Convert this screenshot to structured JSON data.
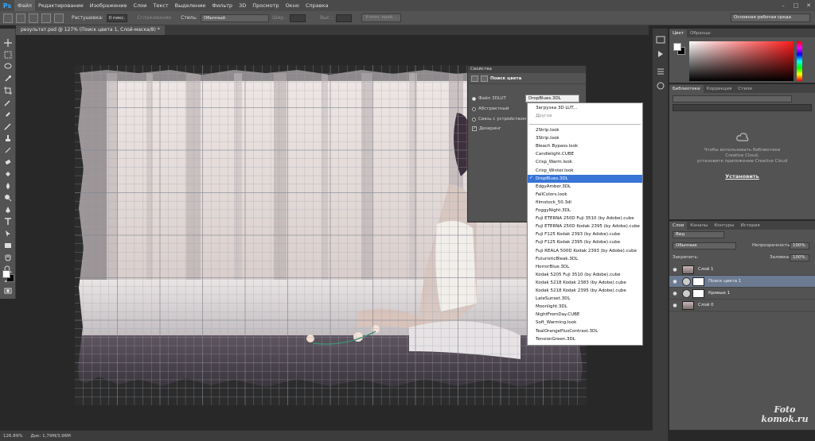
{
  "app": {
    "logo": "Ps",
    "menu": [
      "Файл",
      "Редактирование",
      "Изображение",
      "Слои",
      "Текст",
      "Выделение",
      "Фильтр",
      "3D",
      "Просмотр",
      "Окно",
      "Справка"
    ],
    "window_controls": [
      "–",
      "□",
      "✕"
    ]
  },
  "options": {
    "feather_label": "Растушевка:",
    "feather_value": "0 пикс.",
    "antialias_label": "Сглаживание",
    "style_label": "Стиль:",
    "style_value": "Обычный",
    "width_label": "Шир.:",
    "height_label": "Выс.:",
    "refine_label": "Уточн. край...",
    "workspace": "Основная рабочая среда"
  },
  "document": {
    "tab_label": "результат.psd @ 127% (Поиск цвета 1, Слой-маска/8) *"
  },
  "status": {
    "zoom": "126.89%",
    "doc_size": "Док: 1,79M/3,96M"
  },
  "properties": {
    "header": "Свойства",
    "title": "Поиск цвета",
    "options": [
      "Файл 3DLUT",
      "Абстрактный",
      "Связь с устройством",
      "Дизеринг"
    ],
    "lut_selected": "DropBlues.3DL"
  },
  "dropdown": {
    "top_items": [
      "Загрузка 3D LUT...",
      "Другое"
    ],
    "items": [
      "2Strip.look",
      "3Strip.look",
      "Bleach Bypass.look",
      "Candlelight.CUBE",
      "Crisp_Warm.look",
      "Crisp_Winter.look",
      "DropBlues.3DL",
      "EdgyAmber.3DL",
      "FallColors.look",
      "filmstock_50.3dl",
      "FoggyNight.3DL",
      "Fuji ETERNA 250D Fuji 3510 (by Adobe).cube",
      "Fuji ETERNA 250D Kodak 2395 (by Adobe).cube",
      "Fuji F125 Kodak 2393 (by Adobe).cube",
      "Fuji F125 Kodak 2395 (by Adobe).cube",
      "Fuji REALA 500D Kodak 2393 (by Adobe).cube",
      "FuturisticBleak.3DL",
      "HorrorBlue.3DL",
      "Kodak 5205 Fuji 3510 (by Adobe).cube",
      "Kodak 5218 Kodak 2383 (by Adobe).cube",
      "Kodak 5218 Kodak 2395 (by Adobe).cube",
      "LateSunset.3DL",
      "Moonlight.3DL",
      "NightFromDay.CUBE",
      "Soft_Warming.look",
      "TealOrangePlusContrast.3DL",
      "TensionGreen.3DL"
    ],
    "selected_index": 6
  },
  "color_panel": {
    "tabs": [
      "Цвет",
      "Образцы"
    ]
  },
  "libraries_panel": {
    "tabs": [
      "Библиотеки",
      "Коррекция",
      "Стили"
    ],
    "message": [
      "Чтобы использовать библиотеки",
      "Creative Cloud,",
      "установите приложение Creative Cloud"
    ],
    "install_label": "Установить"
  },
  "layers_panel": {
    "tabs": [
      "Слои",
      "Каналы",
      "Контуры",
      "История"
    ],
    "kind_label": "Вид",
    "blend_mode": "Обычные",
    "opacity_label": "Непрозрачность:",
    "opacity_value": "100%",
    "lock_label": "Закрепить:",
    "fill_label": "Заливка:",
    "fill_value": "100%",
    "layers": [
      {
        "name": "Слой 1",
        "type": "image",
        "selected": false
      },
      {
        "name": "Поиск цвета 1",
        "type": "adjustment",
        "selected": true
      },
      {
        "name": "Кривые 1",
        "type": "adjustment",
        "selected": false
      },
      {
        "name": "Слой 0",
        "type": "image",
        "selected": false
      }
    ]
  },
  "watermark": [
    "Foto",
    "komok.ru"
  ],
  "colors": {
    "selection_blue": "#3875d7",
    "layer_selected": "#6c7a92",
    "ps_blue": "#31a8ff"
  }
}
